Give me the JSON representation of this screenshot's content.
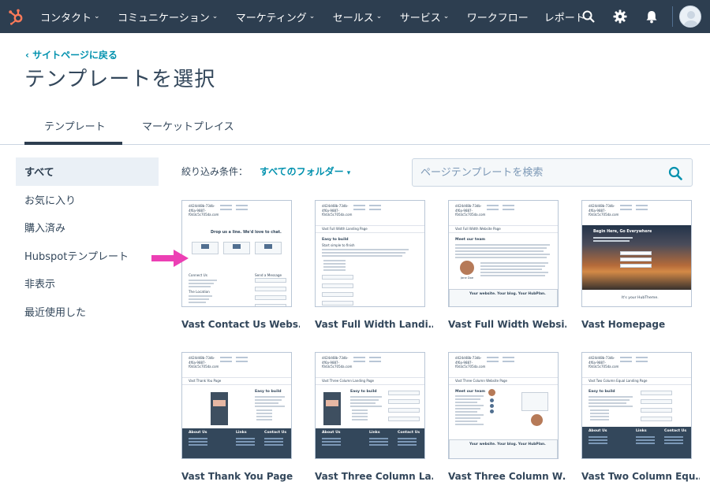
{
  "nav": {
    "items": [
      {
        "label": "コンタクト",
        "has_menu": true
      },
      {
        "label": "コミュニケーション",
        "has_menu": true
      },
      {
        "label": "マーケティング",
        "has_menu": true
      },
      {
        "label": "セールス",
        "has_menu": true
      },
      {
        "label": "サービス",
        "has_menu": true
      },
      {
        "label": "ワークフロー",
        "has_menu": false
      },
      {
        "label": "レポート",
        "has_menu": true
      }
    ],
    "icons": [
      "hubspot-logo-icon",
      "search-icon",
      "gear-icon",
      "bell-icon",
      "user-avatar"
    ],
    "chevron": "⌄"
  },
  "header": {
    "back_link": "‹ サイトページに戻る",
    "title": "テンプレートを選択"
  },
  "tabs": [
    {
      "label": "テンプレート",
      "active": true
    },
    {
      "label": "マーケットプレイス",
      "active": false
    }
  ],
  "sidebar": {
    "items": [
      {
        "label": "すべて",
        "active": true
      },
      {
        "label": "お気に入り"
      },
      {
        "label": "購入済み"
      },
      {
        "label": "Hubspotテンプレート"
      },
      {
        "label": "非表示"
      },
      {
        "label": "最近使用した"
      }
    ]
  },
  "filter": {
    "label": "絞り込み条件：",
    "value": "すべてのフォルダー",
    "caret": "▾"
  },
  "search": {
    "placeholder": "ページテンプレートを検索",
    "value": ""
  },
  "thumb_common": {
    "site_id": "d424d48b-73db-4f6a-9887-f0d3c5c705da.com",
    "nav_links": 4
  },
  "templates": [
    {
      "name": "Vast Contact Us Webs…",
      "banner": "",
      "headline": "Drop us a line. We'd love to chat.",
      "left_label": "Connect Us",
      "right_label": "Send a Message",
      "left_label_2": "The Location"
    },
    {
      "name": "Vast Full Width Landi…",
      "banner": "Vast Full Width Landing Page",
      "heading": "Easy to build",
      "sub": "Start simple to finish"
    },
    {
      "name": "Vast Full Width Websi…",
      "banner": "Vast Full Width Website Page",
      "heading": "Meet our team",
      "person": "Jane Doe",
      "footer_text": "Your website. Your blog. Your HubPlan."
    },
    {
      "name": "Vast Homepage",
      "hero_title": "Begin Here, Go Everywhere",
      "footer_text": "It's your HubTheme."
    },
    {
      "name": "Vast Thank You Page",
      "banner": "Vast Thank You Page",
      "heading": "Easy to build",
      "footer_cols": [
        "About Us",
        "Links",
        "Contact Us"
      ]
    },
    {
      "name": "Vast Three Column La…",
      "banner": "Vast Three Column Landing Page",
      "heading": "Easy to build",
      "footer_cols": [
        "About Us",
        "Links",
        "Contact Us"
      ]
    },
    {
      "name": "Vast Three Column W…",
      "banner": "Vast Three Column Website Page",
      "heading": "Meet our team",
      "footer_text": "Your website. Your blog. Your HubPlan."
    },
    {
      "name": "Vast Two Column Equ…",
      "banner": "Vast Two Column Equal Landing Page",
      "heading": "Easy to build",
      "footer_cols": [
        "About Us",
        "Links",
        "Contact Us"
      ]
    }
  ],
  "colors": {
    "nav_bg": "#2d3e50",
    "accent_link": "#0091ae",
    "hubspot_orange": "#ff7a59",
    "sidebar_active_bg": "#eaf0f6",
    "annotation_arrow": "#ec3fb4"
  }
}
